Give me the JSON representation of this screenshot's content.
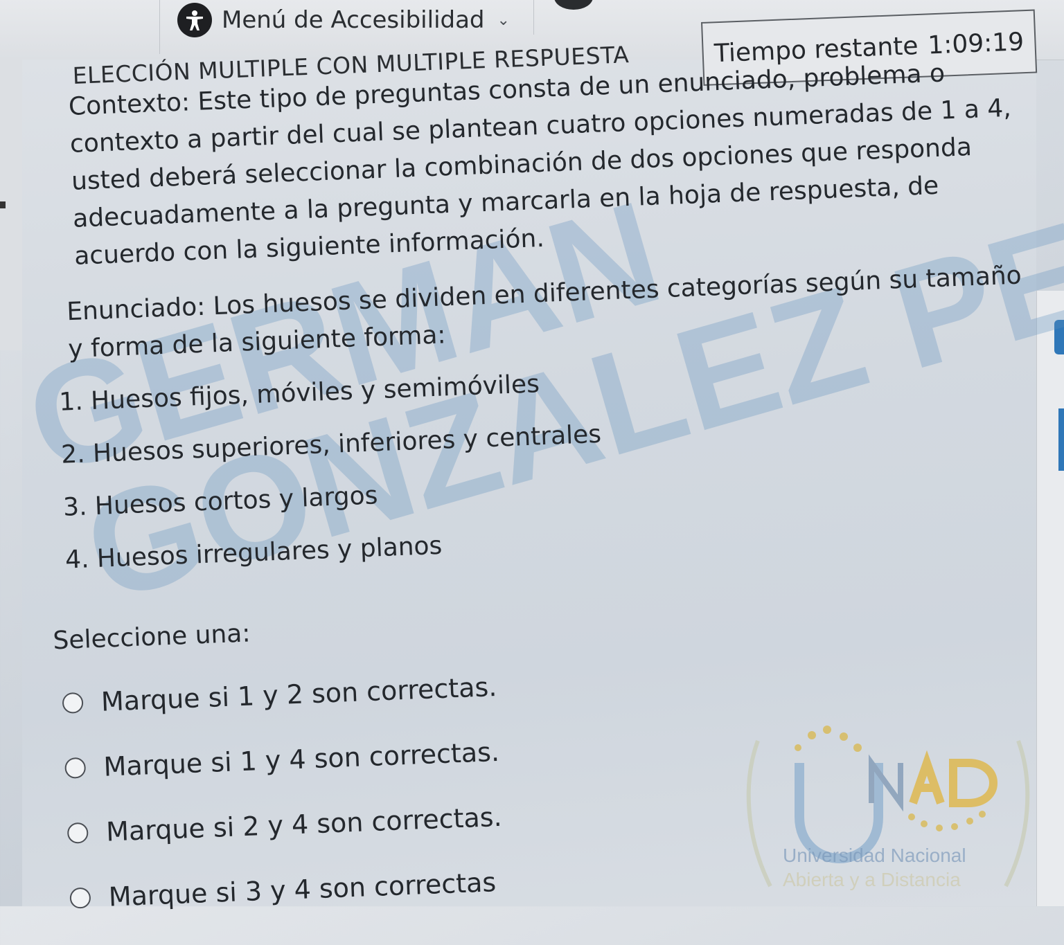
{
  "accessibility_menu": {
    "label": "Menú de Accesibilidad"
  },
  "quiz": {
    "title": "ELECCIÓN MULTIPLE CON MULTIPLE RESPUESTA",
    "timer": {
      "label": "Tiempo restante",
      "value": "1:09:19"
    },
    "context": "Contexto: Este tipo de preguntas consta de un enunciado, problema o contexto a partir del cual se plantean cuatro opciones numeradas de 1 a 4, usted deberá seleccionar la combinación de dos opciones que responda adecuadamente a la pregunta y marcarla en la hoja de respuesta, de acuerdo con la siguiente información.",
    "statement": "Enunciado: Los huesos se dividen en diferentes categorías según su tamaño y forma de la siguiente forma:",
    "items": [
      "1. Huesos fijos, móviles y semimóviles",
      "2. Huesos superiores, inferiores y centrales",
      "3. Huesos cortos y largos",
      "4. Huesos irregulares y planos"
    ],
    "select_label": "Seleccione una:",
    "options": [
      "Marque si 1 y 2 son correctas.",
      "Marque si 1 y 4 son correctas.",
      "Marque si 2 y 4 son correctas.",
      "Marque si 3 y 4 son correctas"
    ]
  },
  "watermark": {
    "line1": "GERMAN",
    "line2": "GONZALEZ PENA"
  },
  "logo": {
    "name": "UNAD",
    "line1": "Universidad Nacional",
    "line2": "Abierta y a Distancia"
  },
  "colors": {
    "accent": "#2f77b8",
    "watermark": "#5c8ebe",
    "logo_gold": "#e0b43c"
  },
  "icons": {
    "accessibility": "accessibility-person-icon",
    "dropdown": "chevron-down-icon",
    "radio": "radio-unchecked"
  }
}
